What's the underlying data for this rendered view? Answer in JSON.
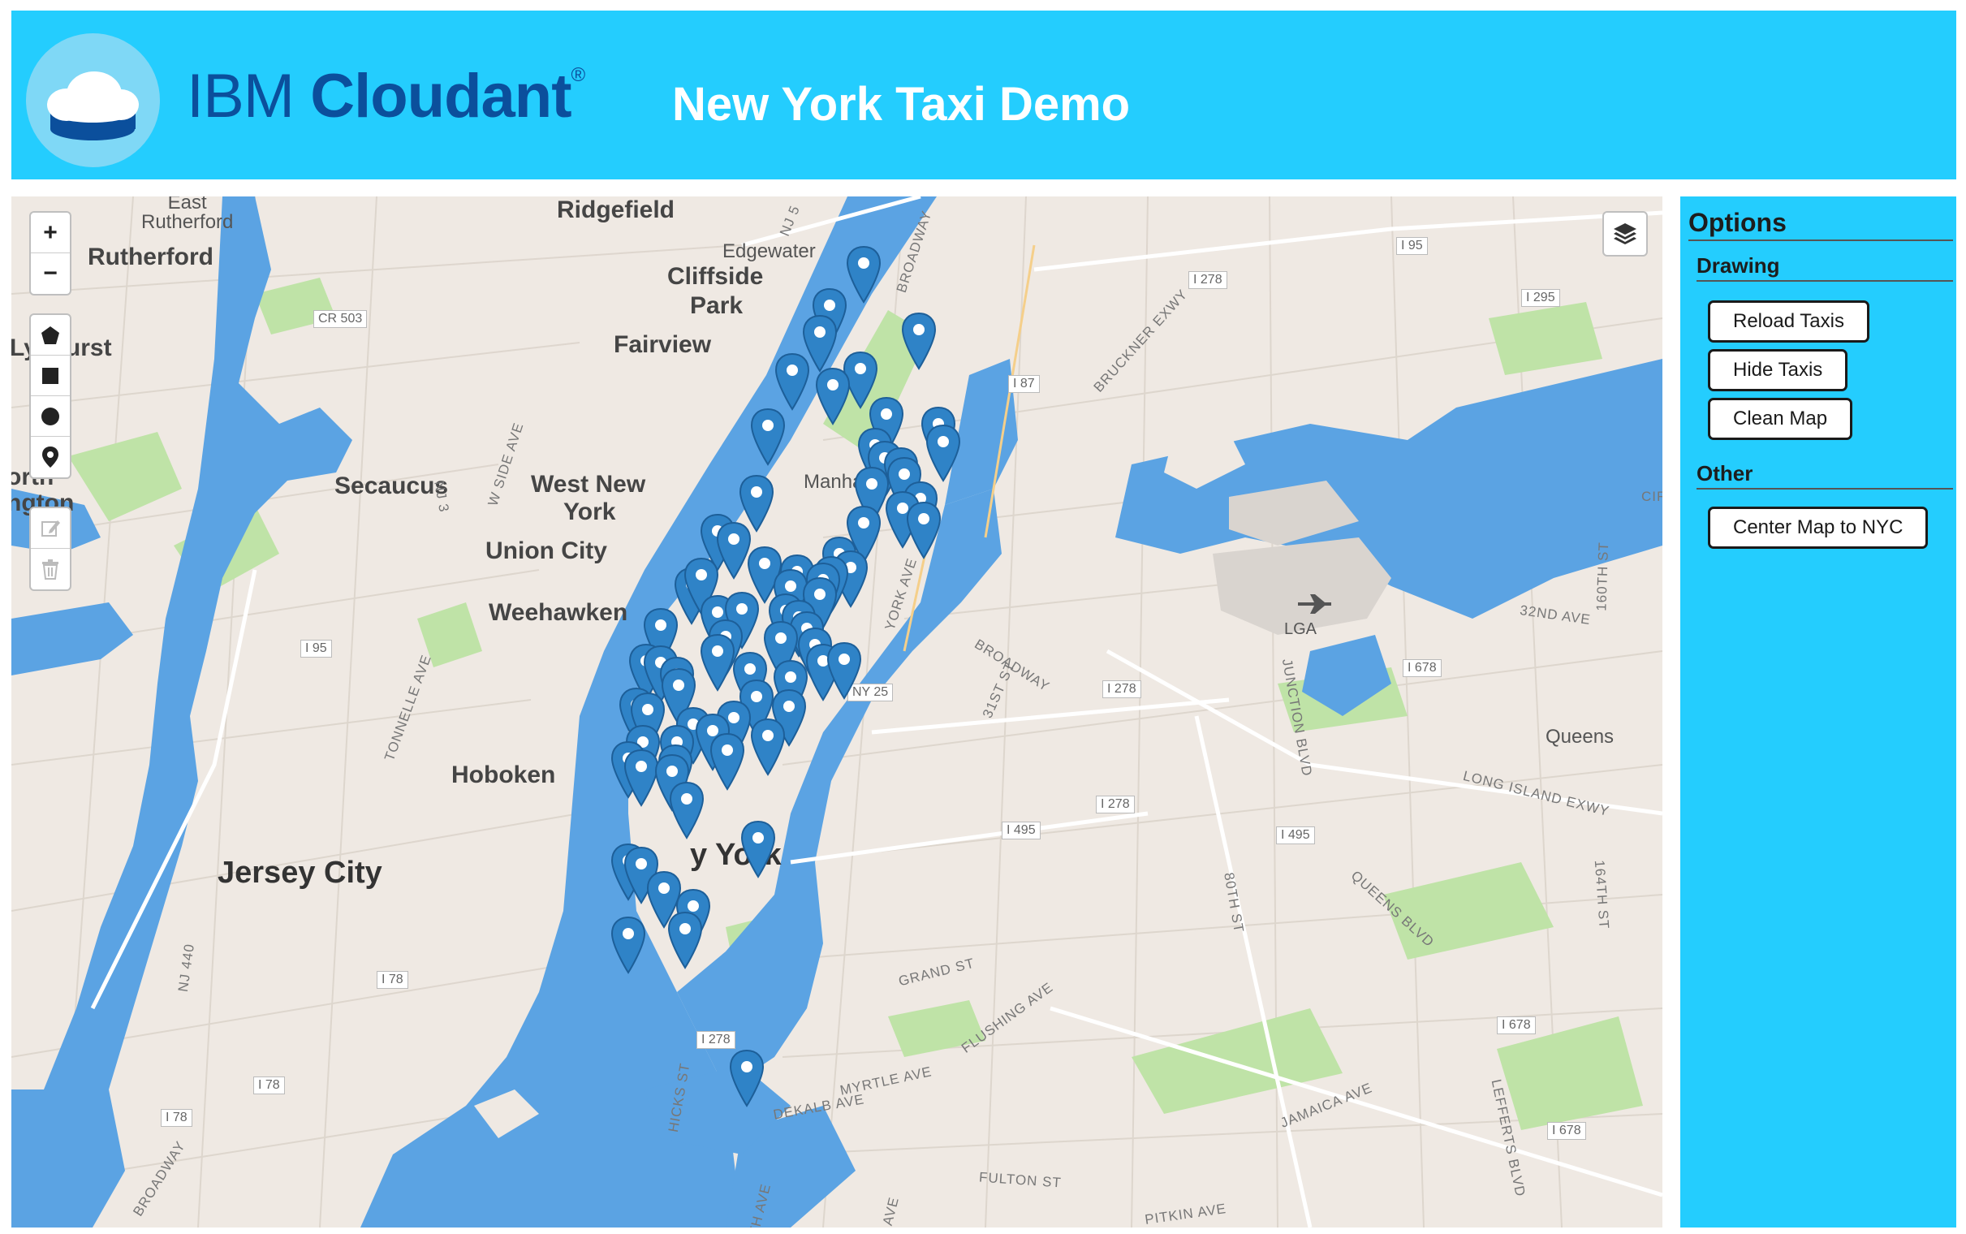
{
  "header": {
    "brand_light": "IBM ",
    "brand_bold": "Cloudant",
    "brand_reg": "®",
    "title": "New York Taxi Demo",
    "accent_color": "#24cdfe"
  },
  "map": {
    "controls": {
      "zoom_in": "+",
      "zoom_out": "−",
      "draw_tools": [
        "polygon-icon",
        "rectangle-icon",
        "circle-icon",
        "marker-icon"
      ],
      "edit_tools": [
        "edit-icon",
        "trash-icon"
      ],
      "layers": "layers-icon"
    },
    "labels": {
      "east_rutherford": "East\nRutherford",
      "rutherford": "Rutherford",
      "lyndhurst": "Ly  hurst",
      "ridgefield": "Ridgefield",
      "edgewater": "Edgewater",
      "cliffside": "Cliffside",
      "park": "Park",
      "fairview": "Fairview",
      "secaucus": "Secaucus",
      "west_new": "West New",
      "york_wny": "York",
      "union_city": "Union City",
      "weehawken": "Weehawken",
      "hoboken": "Hoboken",
      "jersey_city": "Jersey City",
      "manhattan": "Manha",
      "new_york": "y York",
      "queens": "Queens",
      "lga": "LGA",
      "north_bergen": "orth\nngton"
    },
    "roads": {
      "broadway_n": "BROADWAY",
      "broadway_q": "BROADWAY",
      "broadway_sw": "BROADWAY",
      "bruckner": "BRUCKNER EXWY",
      "w_side": "W SIDE AVE",
      "tonnelle": "TONNELLE AVE",
      "york_ave": "YORK AVE",
      "st_31": "31ST ST",
      "junction": "JUNCTION BLVD",
      "lie": "LONG ISLAND EXWY",
      "queens_blvd": "QUEENS BLVD",
      "st_80": "80TH ST",
      "grand_st": "GRAND ST",
      "flushing": "FLUSHING AVE",
      "myrtle": "MYRTLE AVE",
      "dekalb": "DEKALB AVE",
      "jamaica": "JAMAICA AVE",
      "fulton": "FULTON ST",
      "pitkin": "PITKIN AVE",
      "hicks": "HICKS ST",
      "lefferts": "LEFFERTS BLVD",
      "st_164": "164TH ST",
      "st_160": "160TH ST",
      "ave_32": "32ND AVE",
      "nj_440": "NJ 440",
      "nj3": "NJ 3",
      "nj5": "NJ 5",
      "th_ave": "TH AVE",
      "ave_b": "AVE",
      "cir": "CIR"
    },
    "shields": {
      "i95_a": "I 95",
      "i278_a": "I 278",
      "i295": "I 295",
      "i87": "I 87",
      "cr503": "CR 503",
      "i95_b": "I 95",
      "ny25": "NY 25",
      "i278_b": "I 278",
      "i678_a": "I 678",
      "i278_c": "I 278",
      "i495_a": "I 495",
      "i495_b": "I 495",
      "i78_a": "I 78",
      "i78_b": "I 78",
      "i78_c": "I 78",
      "i278_d": "I 278",
      "i678_b": "I 678",
      "i678_c": "I 678"
    }
  },
  "sidebar": {
    "title": "Options",
    "drawing_title": "Drawing",
    "reload": "Reload Taxis",
    "hide": "Hide Taxis",
    "clean": "Clean Map",
    "other_title": "Other",
    "center": "Center Map to NYC"
  },
  "colors": {
    "water": "#5ba3e3",
    "land": "#efe9e3",
    "park": "#bfe3a7",
    "pin": "#2f83c7"
  }
}
